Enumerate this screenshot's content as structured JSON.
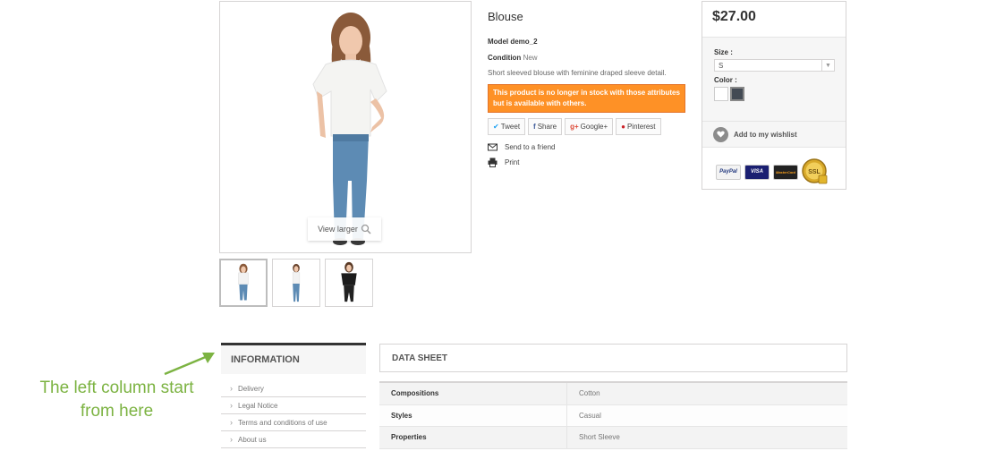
{
  "product": {
    "view_larger": "View larger",
    "title": "Blouse",
    "model_label": "Model",
    "model_value": "demo_2",
    "condition_label": "Condition",
    "condition_value": "New",
    "description": "Short sleeved blouse with feminine draped sleeve detail.",
    "stock_warning": "This product is no longer in stock with those attributes but is available with others.",
    "share": {
      "tweet": "Tweet",
      "share": "Share",
      "google": "Google+",
      "pinterest": "Pinterest"
    },
    "send_to_friend": "Send to a friend",
    "print": "Print"
  },
  "buy_box": {
    "price": "$27.00",
    "size_label": "Size :",
    "size_value": "S",
    "color_label": "Color :",
    "colors": [
      "#ffffff",
      "#434a54"
    ],
    "wishlist": "Add to my wishlist",
    "payment": {
      "paypal": "PayPal",
      "visa": "VISA",
      "mastercard": "MasterCard",
      "ssl": "SSL"
    }
  },
  "information": {
    "heading": "INFORMATION",
    "items": [
      "Delivery",
      "Legal Notice",
      "Terms and conditions of use",
      "About us"
    ]
  },
  "data_sheet": {
    "heading": "DATA SHEET",
    "rows": [
      {
        "key": "Compositions",
        "value": "Cotton"
      },
      {
        "key": "Styles",
        "value": "Casual"
      },
      {
        "key": "Properties",
        "value": "Short Sleeve"
      }
    ]
  },
  "annotation": {
    "line1": "The left column start",
    "line2": "from here",
    "color": "#7cb342"
  }
}
